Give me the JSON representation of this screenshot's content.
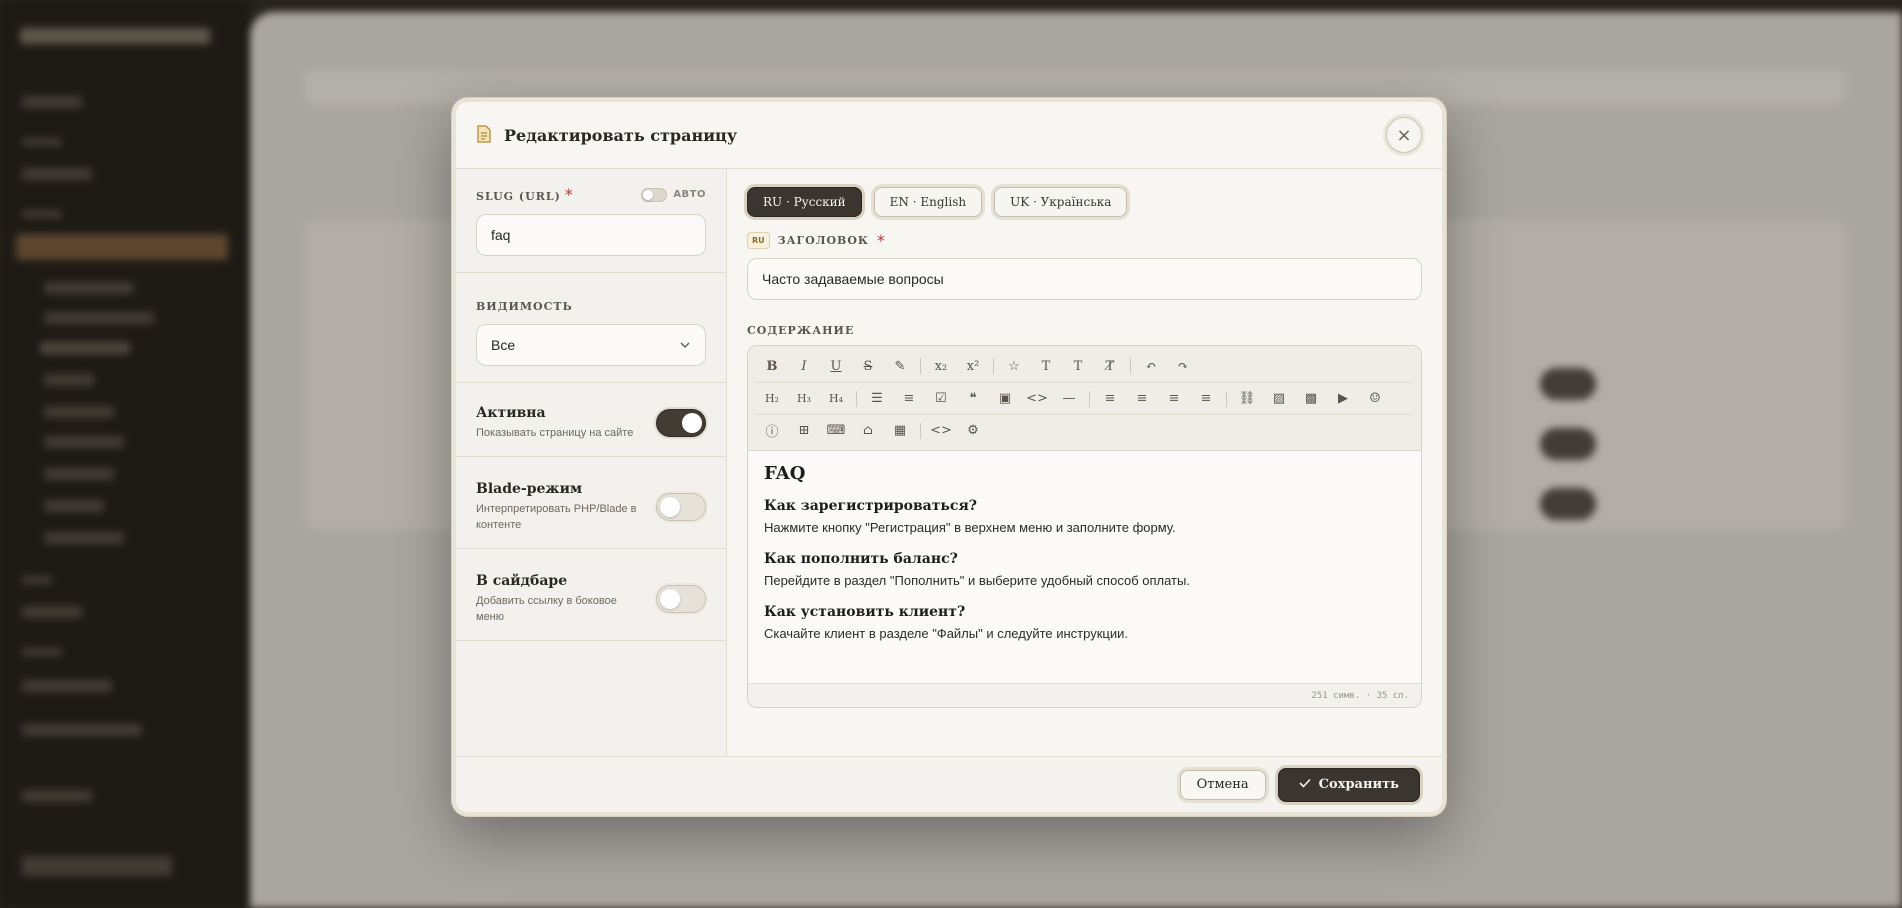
{
  "dialog": {
    "title": "Редактировать страницу",
    "close_symbol": "×"
  },
  "left": {
    "slug": {
      "label": "SLUG (URL)",
      "required": "*",
      "auto_label": "АВТО",
      "auto_enabled": false,
      "value": "faq"
    },
    "visibility": {
      "label": "ВИДИМОСТЬ",
      "selected": "Все"
    },
    "toggles": [
      {
        "title": "Активна",
        "subtitle": "Показывать страницу на сайте",
        "on": true
      },
      {
        "title": "Blade-режим",
        "subtitle": "Интерпретировать PHP/Blade в контенте",
        "on": false
      },
      {
        "title": "В сайдбаре",
        "subtitle": "Добавить ссылку в боковое меню",
        "on": false
      }
    ]
  },
  "right": {
    "tabs": [
      {
        "label": "RU · Русский",
        "active": true
      },
      {
        "label": "EN · English",
        "active": false
      },
      {
        "label": "UK · Українська",
        "active": false
      }
    ],
    "title_field": {
      "lang_badge": "RU",
      "label": "ЗАГОЛОВОК",
      "required": "*",
      "value": "Часто задаваемые вопросы"
    },
    "content_label": "СОДЕРЖАНИЕ",
    "editor": {
      "h1": "FAQ",
      "sections": [
        {
          "heading": "Как зарегистрироваться?",
          "text": "Нажмите кнопку \"Регистрация\" в верхнем меню и заполните форму."
        },
        {
          "heading": "Как пополнить баланс?",
          "text": "Перейдите в раздел \"Пополнить\" и выберите удобный способ оплаты."
        },
        {
          "heading": "Как установить клиент?",
          "text": "Скачайте клиент в разделе \"Файлы\" и следуйте инструкции."
        }
      ],
      "counter": "251 симв. · 35 сл."
    }
  },
  "footer": {
    "cancel_label": "Отмена",
    "save_label": "Сохранить"
  },
  "colors": {
    "accent_dark": "#3b352f",
    "required": "#b43a2a",
    "backdrop": "#2a2520"
  }
}
